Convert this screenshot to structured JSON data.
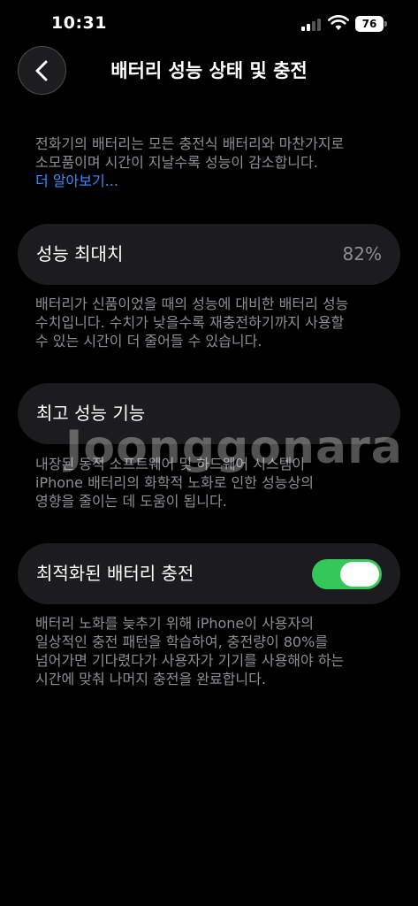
{
  "status": {
    "time": "10:31",
    "battery": "76"
  },
  "nav": {
    "title": "배터리 성능 상태 및 충전"
  },
  "intro": {
    "line1": "전화기의 배터리는 모든 충전식 배터리와 마찬가지로",
    "line2": "소모품이며 시간이 지날수록 성능이 감소합니다.",
    "link": "더 알아보기..."
  },
  "max_capacity": {
    "label": "성능 최대치",
    "value": "82%",
    "desc_lines": [
      "배터리가 신품이었을 때의 성능에 대비한 배터리 성능",
      "수치입니다. 수치가 낮을수록 재충전하기까지 사용할",
      "수 있는 시간이 더 줄어들 수 있습니다."
    ]
  },
  "peak_performance": {
    "label": "최고 성능 기능",
    "desc_lines": [
      "내장된 동적 소프트웨어 및 하드웨어 시스템이",
      "iPhone 배터리의 화학적 노화로 인한 성능상의",
      "영향을 줄이는 데 도움이 됩니다."
    ]
  },
  "optimized_charging": {
    "label": "최적화된 배터리 충전",
    "enabled": true,
    "desc_lines": [
      "배터리 노화를 늦추기 위해 iPhone이 사용자의",
      "일상적인 충전 패턴을 학습하여, 충전량이 80%를",
      "넘어가면 기다렸다가 사용자가 기기를 사용해야 하는",
      "시간에 맞춰 나머지 충전을 완료합니다."
    ]
  },
  "watermark": "Joonggonara",
  "colors": {
    "background": "#000000",
    "card": "#1c1c1e",
    "secondary_text": "#8d8d93",
    "link": "#3a8cff",
    "toggle_on": "#34c759"
  },
  "icons": {
    "back": "chevron-left-icon",
    "signal": "cellular-signal-icon",
    "wifi": "wifi-icon",
    "battery": "battery-icon"
  }
}
